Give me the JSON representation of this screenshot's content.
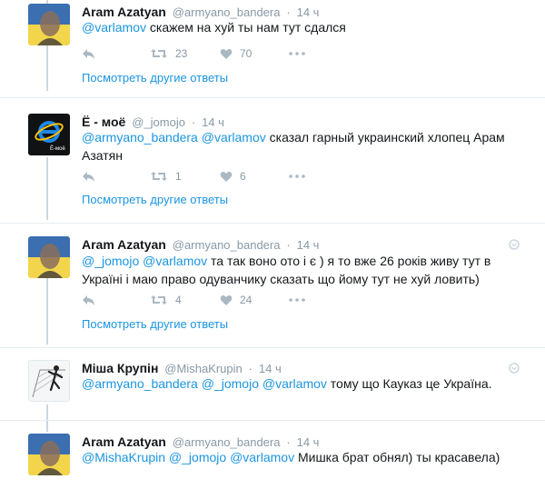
{
  "tweets": [
    {
      "name": "Aram Azatyan",
      "handle": "@armyano_bandera",
      "dot": "·",
      "time": "14 ч",
      "mention1": "@varlamov",
      "text1": " скажем на хуй ты нам тут сдался",
      "retweets": "23",
      "likes": "70",
      "show_more": "Посмотреть другие ответы"
    },
    {
      "name": "Ё - моё",
      "handle": "@_jomojo",
      "dot": "·",
      "time": "14 ч",
      "mention1": "@armyano_bandera",
      "mention2": "@varlamov",
      "text1": " сказал гарный украинский хлопец Арам",
      "text2": "Азатян",
      "retweets": "1",
      "likes": "6",
      "show_more": "Посмотреть другие ответы"
    },
    {
      "name": "Aram Azatyan",
      "handle": "@armyano_bandera",
      "dot": "·",
      "time": "14 ч",
      "mention1": "@_jomojo",
      "mention2": "@varlamov",
      "text1": " та так воно ото і є ) я то вже 26 років живу тут в",
      "text2": "Україні і маю право  одуванчику сказать що йому тут не хуй ловить)",
      "retweets": "4",
      "likes": "24",
      "show_more": "Посмотреть другие ответы"
    },
    {
      "name": "Міша Крупін",
      "handle": "@MishaKrupin",
      "dot": "·",
      "time": "14 ч",
      "mention1": "@armyano_bandera",
      "mention2": "@_jomojo",
      "mention3": "@varlamov",
      "text1": " тому що Кауказ це Україна."
    },
    {
      "name": "Aram Azatyan",
      "handle": "@armyano_bandera",
      "dot": "·",
      "time": "14 ч",
      "mention1": "@MishaKrupin",
      "mention2": "@_jomojo",
      "mention3": "@varlamov",
      "text1": " Мишка брат обнял) ты красавела)"
    }
  ],
  "avatar_logo_text": "Ё-моё",
  "icons": {
    "reply": "reply-icon",
    "retweet": "retweet-icon",
    "like": "heart-icon",
    "more": "more-dots-icon",
    "caret": "chevron-down-icon"
  },
  "colors": {
    "link": "#1b95e0",
    "muted": "#8899a6",
    "icon": "#aab8c2",
    "thread": "#ccd6dd"
  }
}
